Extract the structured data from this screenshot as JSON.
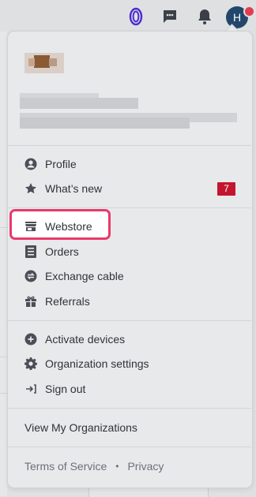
{
  "topbar": {
    "icons": [
      "app-logo-icon",
      "chat-icon",
      "bell-icon"
    ],
    "avatar_initial": "H",
    "notification_color": "#e23c4f"
  },
  "menu": {
    "section1": [
      {
        "label": "Profile",
        "icon": "user-circle-icon"
      },
      {
        "label": "What’s new",
        "icon": "star-icon",
        "badge": "7"
      }
    ],
    "section2": [
      {
        "label": "Webstore",
        "icon": "store-icon"
      },
      {
        "label": "Orders",
        "icon": "list-icon"
      },
      {
        "label": "Exchange cable",
        "icon": "exchange-icon"
      },
      {
        "label": "Referrals",
        "icon": "gift-icon"
      }
    ],
    "section3": [
      {
        "label": "Activate devices",
        "icon": "plus-circle-icon"
      },
      {
        "label": "Organization settings",
        "icon": "gear-icon"
      },
      {
        "label": "Sign out",
        "icon": "sign-out-icon"
      }
    ],
    "view_orgs": "View My Organizations",
    "footer": {
      "terms": "Terms of Service",
      "separator": "•",
      "privacy": "Privacy"
    }
  },
  "colors": {
    "highlight_border": "#e83a6a",
    "badge_bg": "#c4152e",
    "avatar_bg": "#23476b"
  }
}
